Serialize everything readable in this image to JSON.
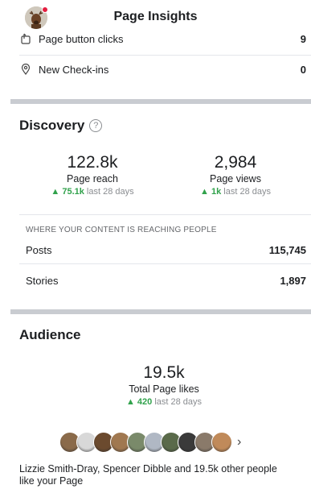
{
  "header": {
    "title": "Page Insights"
  },
  "metrics": [
    {
      "icon": "pointer-icon",
      "label": "Page button clicks",
      "value": "9"
    },
    {
      "icon": "location-pin-icon",
      "label": "New Check-ins",
      "value": "0"
    }
  ],
  "discovery": {
    "title": "Discovery",
    "help": "?",
    "reach": {
      "value": "122.8k",
      "label": "Page reach",
      "delta": "75.1k",
      "period": "last 28 days"
    },
    "views": {
      "value": "2,984",
      "label": "Page views",
      "delta": "1k",
      "period": "last 28 days"
    },
    "where_caption": "WHERE YOUR CONTENT IS REACHING PEOPLE",
    "rows": [
      {
        "label": "Posts",
        "value": "115,745"
      },
      {
        "label": "Stories",
        "value": "1,897"
      }
    ]
  },
  "audience": {
    "title": "Audience",
    "likes": {
      "value": "19.5k",
      "label": "Total Page likes",
      "delta": "420",
      "period": "last 28 days"
    },
    "liked_by_text": "Lizzie Smith-Dray, Spencer Dibble and 19.5k other people like your Page",
    "face_colors": [
      "#8a6a4a",
      "#d8d8d8",
      "#6b4a2e",
      "#a07850",
      "#7a8a6a",
      "#b0b8c4",
      "#5a6a4a",
      "#3a3a3a",
      "#8a7a6a",
      "#c08a5a"
    ]
  },
  "colors": {
    "positive": "#31a24c",
    "separator": "#c9ccd1"
  }
}
